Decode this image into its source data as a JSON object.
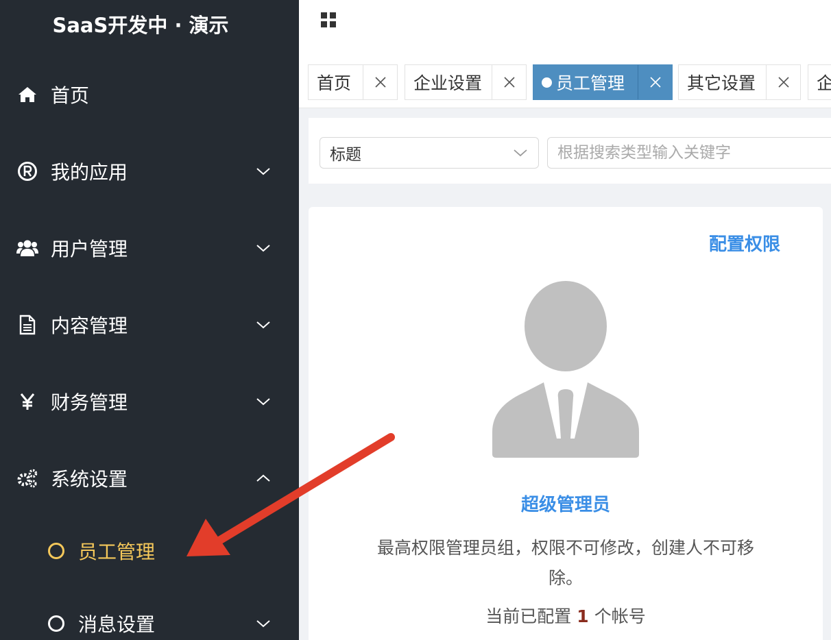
{
  "brand": "SaaS开发中 · 演示",
  "menu": {
    "home": "首页",
    "apps": "我的应用",
    "users": "用户管理",
    "content": "内容管理",
    "finance": "财务管理",
    "system": "系统设置",
    "staff": "员工管理",
    "messages": "消息设置"
  },
  "tabs": {
    "home": "首页",
    "company": "企业设置",
    "staff": "员工管理",
    "other": "其它设置",
    "partial": "企"
  },
  "filter": {
    "select_value": "标题",
    "search_placeholder": "根据搜索类型输入关键字"
  },
  "card": {
    "config_label": "配置权限",
    "role_name": "超级管理员",
    "description": "最高权限管理员组，权限不可修改，创建人不可移除。",
    "count_prefix": "当前已配置",
    "count_value": "1",
    "count_suffix": "个帐号"
  },
  "colors": {
    "sidebar_bg": "#252b32",
    "active_yellow": "#f5c85a",
    "active_tab": "#4e8ec0",
    "link_blue": "#3a8ee6",
    "arrow_red": "#e23d2a"
  }
}
